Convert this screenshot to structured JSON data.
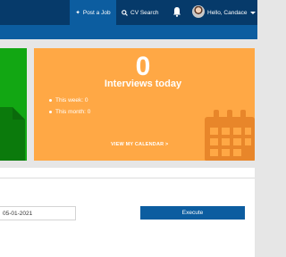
{
  "nav": {
    "post_job": "Post a Job",
    "cv_search": "CV Search",
    "user_greeting": "Hello, Candace"
  },
  "interviews": {
    "count": "0",
    "label": "Interviews today",
    "this_week": "This week: 0",
    "this_month": "This month: 0",
    "calendar_link": "VIEW MY CALENDAR >"
  },
  "report": {
    "date_value": "05-01-2021",
    "execute_label": "Execute"
  },
  "colors": {
    "nav_bg": "#063a6a",
    "accent": "#0c5da0",
    "green_tile": "#12a713",
    "orange_tile": "#ffa845"
  }
}
